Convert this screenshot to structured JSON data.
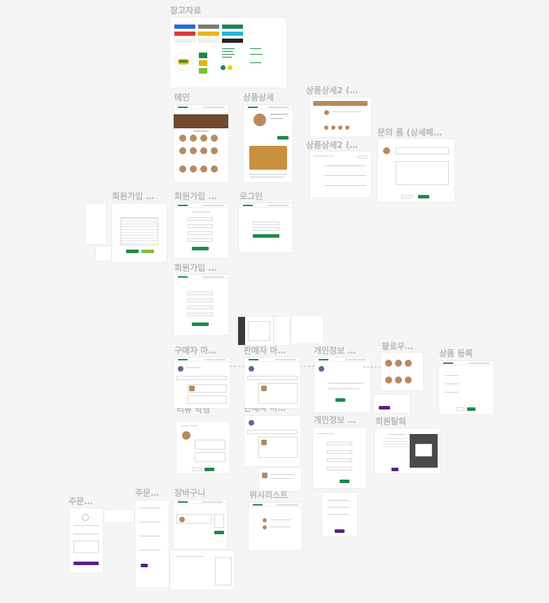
{
  "colors": {
    "brand": "#1d8a4a",
    "accent": "#5b1e8a",
    "label": "#b8b8b8",
    "canvas": "#f5f5f5"
  },
  "frames": {
    "reference": "참고자료",
    "main": "메인",
    "product_detail": "상품상세",
    "product_detail2_a": "상품상세2 (…",
    "product_detail2_b": "상품상세2 (…",
    "inquiry_form": "문의 폼 (상세페…",
    "signup_a": "회원가입 …",
    "signup_b": "회원가입 …",
    "login": "로그인",
    "signup_c": "회원가입 …",
    "buyer_mypage": "구매자 마…",
    "seller_mypage_a": "판매자 마…",
    "personal_info_a": "개인정보 …",
    "follow": "팔로우…",
    "product_register": "상품 등록",
    "review_write": "리뷰 작성",
    "seller_mypage_b": "판매자 마…",
    "personal_info_b": "개인정보 …",
    "withdraw": "회원탈퇴",
    "order_a": "주문…",
    "order_b": "주문…",
    "cart": "장바구니",
    "wishlist": "위시리스트"
  }
}
